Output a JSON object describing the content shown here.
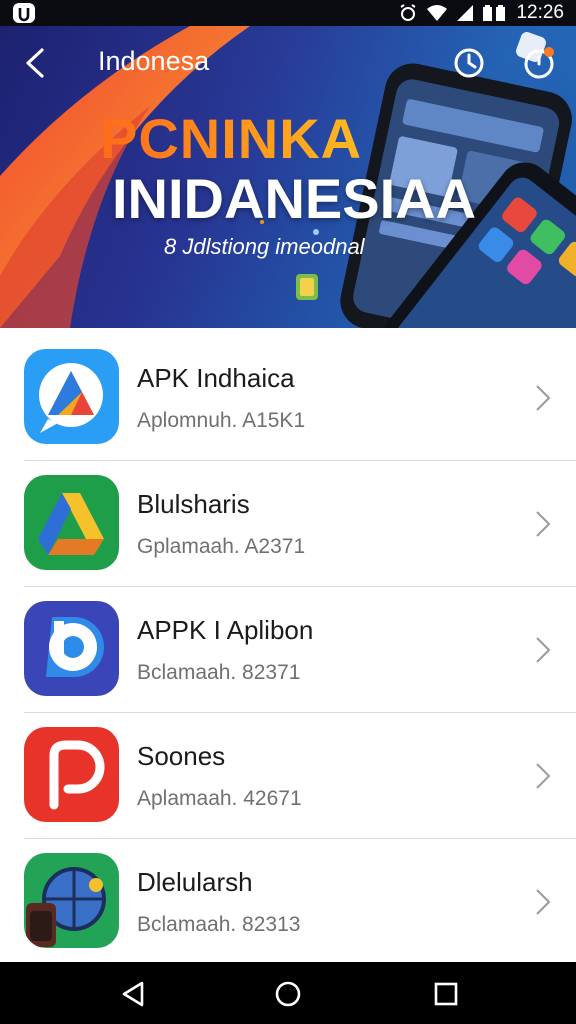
{
  "status_bar": {
    "time": "12:26",
    "left_icon": "app-notification-icon",
    "icons": [
      "alarm-icon",
      "wifi-icon",
      "signal-icon",
      "battery-icon"
    ]
  },
  "header": {
    "title": "Indonesa",
    "back_icon": "back-arrow-icon",
    "actions": [
      "history-icon",
      "timer-icon"
    ]
  },
  "hero": {
    "headline_1": "PCNINKA",
    "headline_2": "INIDANESIAA",
    "subtitle": "8 Jdlstiong imeodnal",
    "colors": {
      "accent_orange": "#ff9a1c",
      "deep_blue": "#1d2270"
    }
  },
  "apps": [
    {
      "name": "APK Indhaica",
      "subtitle": "Aplomnuh. A15K1",
      "icon": "blue-triangle-chat-icon",
      "color": "#2a9df4"
    },
    {
      "name": "Blulsharis",
      "subtitle": "Gplamaah. A2371",
      "icon": "green-drive-triangle-icon",
      "color": "#1e9e48"
    },
    {
      "name": "APPK I Aplibon",
      "subtitle": "Bclamaah. 82371",
      "icon": "blue-d-letter-icon",
      "color": "#3a46b8"
    },
    {
      "name": "Soones",
      "subtitle": "Aplamaah. 42671",
      "icon": "red-p-letter-icon",
      "color": "#e8332b"
    },
    {
      "name": "Dlelularsh",
      "subtitle": "Bclamaah. 82313",
      "icon": "green-globe-app-icon",
      "color": "#22a356"
    }
  ],
  "nav": [
    "nav-back-icon",
    "nav-home-icon",
    "nav-recents-icon"
  ]
}
